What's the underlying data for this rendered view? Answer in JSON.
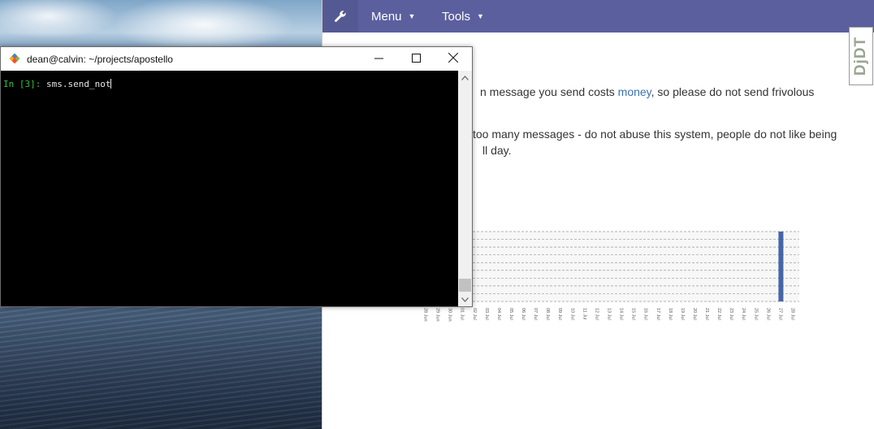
{
  "terminal": {
    "title": "dean@calvin: ~/projects/apostello",
    "prompt": "In [3]: ",
    "input": "sms.send_not",
    "app_icon": "git-diamond-icon",
    "buttons": {
      "minimize": "minimize-icon",
      "maximize": "maximize-icon",
      "close": "close-icon"
    }
  },
  "navbar": {
    "icon": "wrench-icon",
    "menu_label": "Menu",
    "tools_label": "Tools",
    "background": "#5b5f9e"
  },
  "content": {
    "p1_pre": "n message you send costs ",
    "p1_link": "money",
    "p1_post": ", so please do not send frivolous",
    "p2": "too many messages - do not abuse this system, people do not like being",
    "p3": "ll day."
  },
  "debug_toolbar": {
    "label": "DjDT"
  },
  "chart_data": {
    "type": "bar",
    "categories": [
      "28 Jun",
      "29 Jun",
      "30 Jun",
      "01 Jul",
      "02 Jul",
      "03 Jul",
      "04 Jul",
      "05 Jul",
      "06 Jul",
      "07 Jul",
      "08 Jul",
      "09 Jul",
      "10 Jul",
      "11 Jul",
      "12 Jul",
      "13 Jul",
      "14 Jul",
      "15 Jul",
      "16 Jul",
      "17 Jul",
      "18 Jul",
      "19 Jul",
      "20 Jul",
      "21 Jul",
      "22 Jul",
      "23 Jul",
      "24 Jul",
      "25 Jul",
      "26 Jul",
      "27 Jul",
      "28 Jul"
    ],
    "values": [
      0,
      0,
      0,
      0,
      0,
      0,
      0,
      0,
      0,
      0,
      0,
      0,
      0,
      0,
      0,
      0,
      0,
      0,
      0,
      0,
      0,
      0,
      0,
      0,
      0,
      0,
      0,
      0,
      0,
      1,
      0
    ],
    "ylim": [
      0,
      1
    ],
    "grid": true,
    "color": "#4565a8"
  }
}
